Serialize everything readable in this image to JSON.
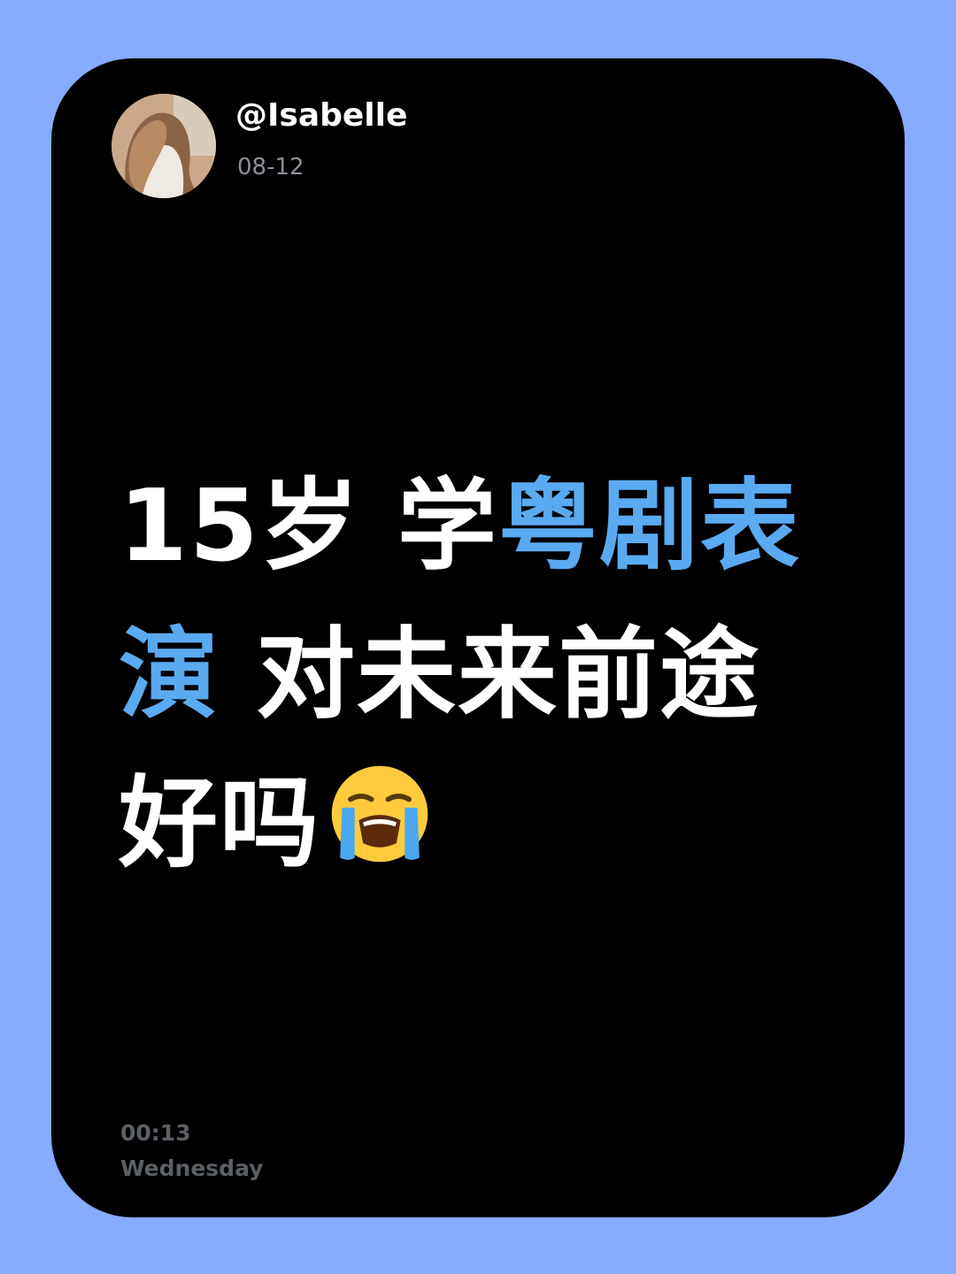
{
  "post": {
    "username": "@Isabelle",
    "date": "08-12",
    "headline": {
      "line1_white": "15岁 学",
      "line1_blue": "粤剧表",
      "line2_blue": "演",
      "line2_white": " 对未来前途",
      "line3_white": "好吗"
    },
    "emoji": "loudly-crying-face-icon",
    "time": "00:13",
    "weekday": "Wednesday"
  },
  "colors": {
    "background": "#86acff",
    "card": "#000000",
    "accent_blue": "#5aaaf2",
    "muted_text": "#5b5f66"
  }
}
